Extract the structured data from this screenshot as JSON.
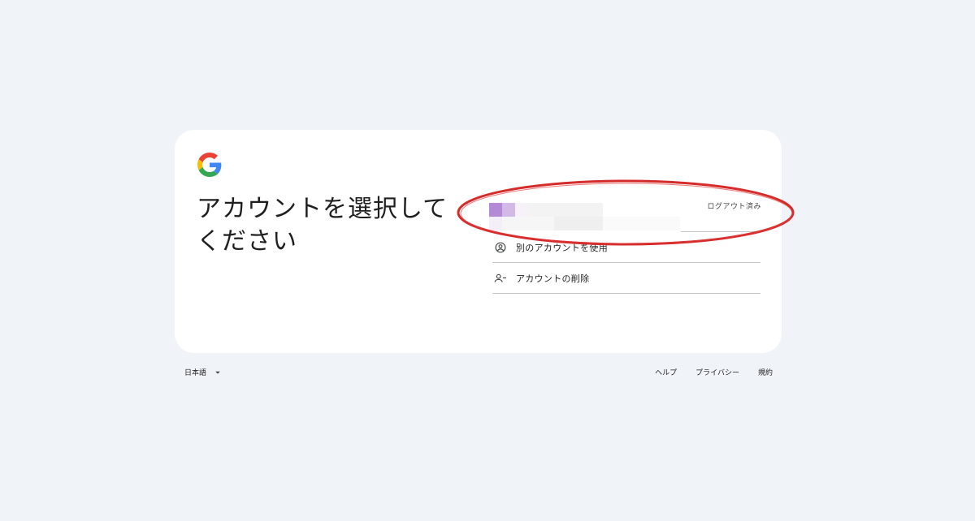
{
  "colors": {
    "page_background": "#f0f4f9",
    "card_background": "#ffffff",
    "highlight": "#d52b2b",
    "google_blue": "#4285f4",
    "google_red": "#ea4335",
    "google_yellow": "#fbbc05",
    "google_green": "#34a853"
  },
  "logo": {
    "icon": "google-g-logo"
  },
  "heading": "アカウントを選択してください",
  "account": {
    "avatar_redacted": true,
    "status": "ログアウト済み"
  },
  "menu": {
    "use_other_account": {
      "label": "別のアカウントを使用",
      "icon": "account-circle-icon"
    },
    "remove_account": {
      "label": "アカウントの削除",
      "icon": "person-remove-icon"
    }
  },
  "annotation": {
    "shape": "ellipse",
    "color": "#d52b2b"
  },
  "footer": {
    "language": "日本語",
    "links": {
      "help": "ヘルプ",
      "privacy": "プライバシー",
      "terms": "規約"
    }
  }
}
